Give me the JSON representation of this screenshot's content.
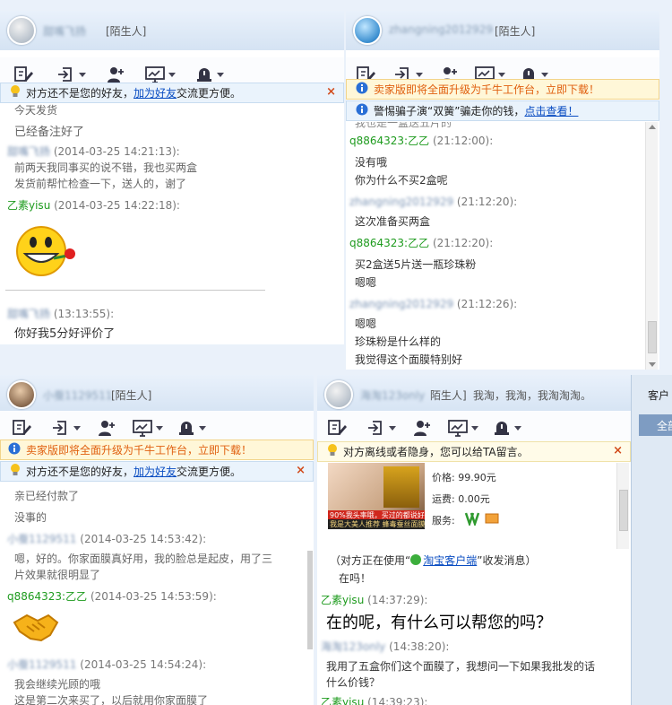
{
  "w1": {
    "contact_name": "甜嘴飞扬",
    "stranger_tag": "[陌生人]",
    "banner_prefix": "对方还不是您的好友，",
    "banner_link": "加为好友",
    "banner_suffix": "交流更方便。",
    "close": "×",
    "m0": "今天发货",
    "m1": "已经备注好了",
    "h1_name": "甜嘴飞扬",
    "h1_time": "(2014-03-25 14:21:13):",
    "m2": "前两天我同事买的说不错，我也买两盒",
    "m3": "发货前帮忙检查一下，送人的，谢了",
    "h2_name": "乙素yisu",
    "h2_time": "(2014-03-25 14:22:18):",
    "emoji": "smile-rose-emoji",
    "h3_name": "甜嘴飞扬",
    "h3_time": "(13:13:55):",
    "m4": "你好我5分好评价了"
  },
  "w2": {
    "contact_name": "zhangning2012929",
    "stranger_tag": "[陌生人]",
    "warn": "卖家版即将全面升级为千牛工作台，立即下载！",
    "alert_prefix": "警惕骗子演“双簧”骗走你的钱，",
    "alert_link": "点击查看！",
    "m0": "我也是一盒送五片的",
    "h1_name": "q8864323:乙乙",
    "h1_time": "(21:12:00):",
    "m1": "没有哦",
    "m2": "你为什么不买2盒呢",
    "h2_name": "zhangning2012929",
    "h2_time": "(21:12:20):",
    "m3": "这次准备买两盒",
    "h3_name": "q8864323:乙乙",
    "h3_time": "(21:12:20):",
    "m4": "买2盒送5片送一瓶珍珠粉",
    "m5": "嗯嗯",
    "h4_name": "zhangning2012929",
    "h4_time": "(21:12:26):",
    "m6": "嗯嗯",
    "m7": "珍珠粉是什么样的",
    "m8": "我觉得这个面膜特别好"
  },
  "w3": {
    "contact_name": "小蚕1129511",
    "stranger_tag": "[陌生人]",
    "warn": "卖家版即将全面升级为千牛工作台，立即下载！",
    "banner_prefix": "对方还不是您的好友，",
    "banner_link": "加为好友",
    "banner_suffix": "交流更方便。",
    "close": "×",
    "m0": "亲已经付款了",
    "m1": "没事的",
    "h1_name": "小蚕1129511",
    "h1_time": "(2014-03-25 14:53:42):",
    "m2": "嗯，好的。你家面膜真好用，我的脸总是起皮，用了三",
    "m3": "片效果就很明显了",
    "h2_name": "q8864323:乙乙",
    "h2_time": "(2014-03-25 14:53:59):",
    "emoji": "handshake-emoji",
    "h3_name": "小蚕1129511",
    "h3_time": "(2014-03-25 14:54:24):",
    "m4": "我会继续光顾的哦",
    "m5": "这是第二次来买了，以后就用你家面膜了"
  },
  "w4": {
    "contact_name": "海淘123only",
    "stranger_tag": "陌生人]",
    "extra": "我淘，我淘，我淘淘淘。",
    "banner": "对方离线或者隐身，您可以给TA留言。",
    "close": "×",
    "product_caption1": "90%我头率哦，买过的都说好",
    "product_caption2": "我是大美人推荐 蜂毒蚕丝面膜",
    "price_label": "价格:",
    "price": "99.90元",
    "shipping_label": "运费:",
    "shipping": "0.00元",
    "service_label": "服务:",
    "client_prefix": "（对方正在使用“",
    "client_link": "淘宝客户端",
    "client_suffix": "”收发消息）",
    "m1": "在吗！",
    "h1_name": "乙素yisu",
    "h1_time": "(14:37:29):",
    "m2": "在的呢，有什么可以帮您的吗？",
    "h2_name": "海淘123only",
    "h2_time": "(14:38:20):",
    "m3": "我用了五盒你们这个面膜了，我想问一下如果我批发的话",
    "m4": "什么价钱？",
    "h3_name": "乙素yisu",
    "h3_time": "(14:39:23):"
  },
  "side": {
    "tab": "客户",
    "btn": "全部"
  },
  "colors": {
    "warn_text": "#e06010",
    "link": "#0a4dc2",
    "me_green": "#1e9b1e",
    "title_bg": "#d5e3f3"
  }
}
